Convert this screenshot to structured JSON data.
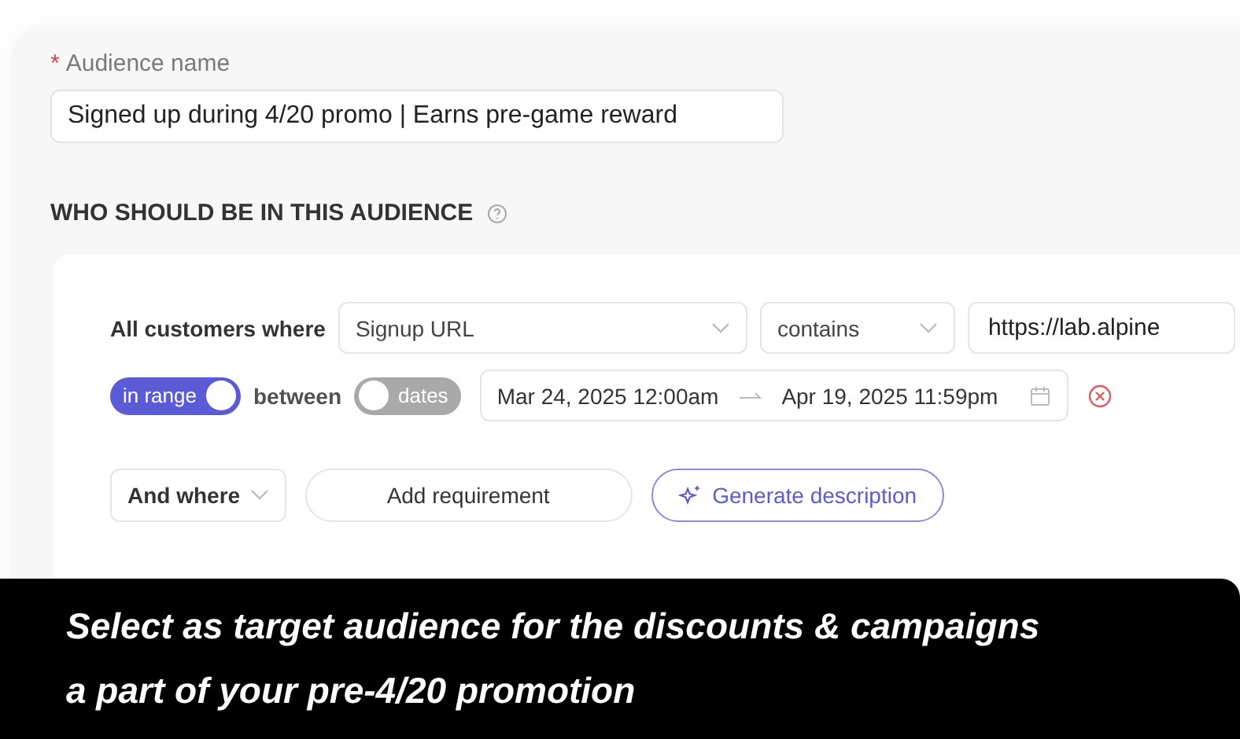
{
  "audience_name": {
    "label": "Audience name",
    "required_mark": "*",
    "value": "Signed up during 4/20 promo | Earns pre-game reward"
  },
  "section_title": "WHO SHOULD BE IN THIS AUDIENCE",
  "condition": {
    "prefix": "All customers where",
    "field": "Signup URL",
    "operator": "contains",
    "value": "https://lab.alpine"
  },
  "range": {
    "toggles": [
      {
        "label": "in range",
        "on": true
      },
      {
        "label": "dates",
        "on": false
      }
    ],
    "between": "between",
    "start": "Mar 24, 2025 12:00am",
    "end": "Apr 19, 2025 11:59pm"
  },
  "actions": {
    "and_where": "And where",
    "add_requirement": "Add requirement",
    "generate": "Generate description"
  },
  "caption": [
    "Select as target audience for the discounts & campaigns",
    "a part of your pre-4/20 promotion"
  ]
}
